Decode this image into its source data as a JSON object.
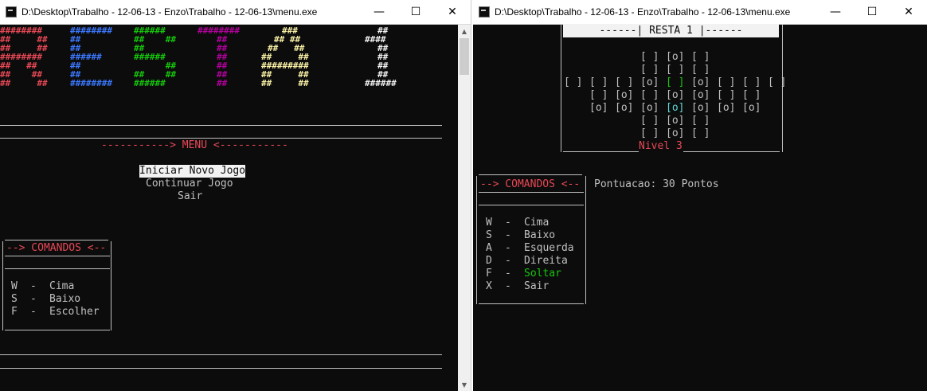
{
  "window1": {
    "title": "D:\\Desktop\\Trabalho - 12-06-13 - Enzo\\Trabalho - 12-06-13\\menu.exe",
    "minimize": "—",
    "maximize": "☐",
    "close": "✕",
    "art_rows": [
      {
        "c1": "########",
        "c2": "########",
        "c3": "######",
        "c4": "########",
        "c5": "###",
        "c6": "##"
      },
      {
        "c1": "##     ##",
        "c2": "##",
        "c3": "##    ##",
        "c4": "##",
        "c5": "## ##",
        "c6": "####"
      },
      {
        "c1": "##     ##",
        "c2": "##",
        "c3": "##",
        "c4": "##",
        "c5": "##   ##",
        "c6": "##"
      },
      {
        "c1": "########",
        "c2": "######",
        "c3": "######",
        "c4": "##",
        "c5": "##     ##",
        "c6": "##"
      },
      {
        "c1": "##   ##",
        "c2": "##",
        "c3": "      ##",
        "c4": "##",
        "c5": "#########",
        "c6": "##"
      },
      {
        "c1": "##    ##",
        "c2": "##",
        "c3": "##    ##",
        "c4": "##",
        "c5": "##     ##",
        "c6": "##"
      },
      {
        "c1": "##     ##",
        "c2": "########",
        "c3": "######",
        "c4": "##",
        "c5": "##     ##",
        "c6": "######"
      }
    ],
    "menu_header": "-----------> MENU <-----------",
    "menu_items": [
      "Iniciar Novo Jogo",
      "Continuar Jogo",
      "Sair"
    ],
    "commands_title": "--> COMANDOS <--",
    "commands": [
      {
        "key": "W",
        "sep": "-",
        "action": "Cima"
      },
      {
        "key": "S",
        "sep": "-",
        "action": "Baixo"
      },
      {
        "key": "F",
        "sep": "-",
        "action": "Escolher"
      }
    ]
  },
  "window2": {
    "title": "D:\\Desktop\\Trabalho - 12-06-13 - Enzo\\Trabalho - 12-06-13\\menu.exe",
    "minimize": "—",
    "maximize": "☐",
    "close": "✕",
    "banner": "------| RESTA 1 |------",
    "board_rows": [
      [
        "[ ]",
        "[o]",
        "[ ]"
      ],
      [
        "[ ]",
        "[ ]",
        "[ ]"
      ],
      [
        "[ ]",
        "[ ]",
        "[ ]",
        "[o]",
        "[ ]",
        "[o]",
        "[ ]",
        "[ ]",
        "[ ]"
      ],
      [
        "[ ]",
        "[o]",
        "[ ]",
        "[o]",
        "[o]",
        "[ ]",
        "[ ]"
      ],
      [
        "[o]",
        "[o]",
        "[o]",
        "[o]",
        "[o]",
        "[o]",
        "[o]"
      ],
      [
        "[ ]",
        "[o]",
        "[ ]"
      ],
      [
        "[ ]",
        "[o]",
        "[ ]"
      ]
    ],
    "level": "Nivel 3",
    "score": "Pontuacao: 30 Pontos",
    "commands_title": "--> COMANDOS <--",
    "commands": [
      {
        "key": "W",
        "sep": "-",
        "action": "Cima"
      },
      {
        "key": "S",
        "sep": "-",
        "action": "Baixo"
      },
      {
        "key": "A",
        "sep": "-",
        "action": "Esquerda"
      },
      {
        "key": "D",
        "sep": "-",
        "action": "Direita"
      },
      {
        "key": "F",
        "sep": "-",
        "action": "Soltar"
      },
      {
        "key": "X",
        "sep": "-",
        "action": "Sair"
      }
    ],
    "colors": {
      "selected_cell": "#16c60c",
      "cursor_cell": "#61d6d6",
      "highlight_command": "#16c60c",
      "accent": "#e74856"
    }
  }
}
